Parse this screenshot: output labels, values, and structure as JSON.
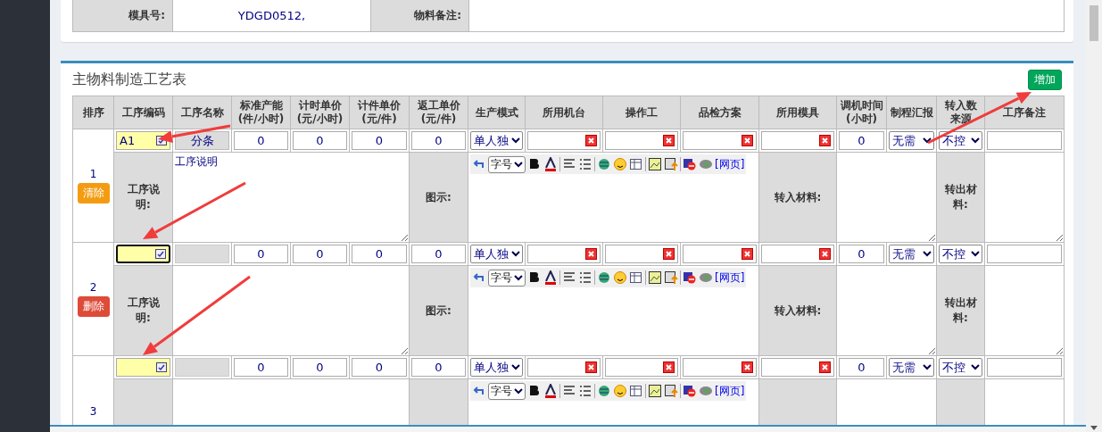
{
  "info_row": [
    {
      "label": "模具号:",
      "value": "YDGD0512,"
    },
    {
      "label": "物料备注:"
    }
  ],
  "section": {
    "title": "主物料制造工艺表",
    "add_button": "增加"
  },
  "columns": [
    "排序",
    "工序编码",
    "工序名称",
    "标准产能\n(件/小时)",
    "计时单价\n(元/小时)",
    "计件单价\n(元/件)",
    "返工单价\n(元/件)",
    "生产模式",
    "所用机台",
    "操作工",
    "品检方案",
    "所用模具",
    "调机时间\n(小时)",
    "制程汇报",
    "转入数来源",
    "工序备注"
  ],
  "rows": [
    {
      "seq": "1",
      "action": {
        "kind": "clear",
        "label": "清除"
      },
      "code": {
        "value": "A1",
        "focused": false
      },
      "name_button": "分条",
      "capacity": "0",
      "hourly_price": "0",
      "piece_price": "0",
      "rework_price": "0",
      "mode": "单人独",
      "adjust_time": "0",
      "report": "无需",
      "source": "不控",
      "editor": {
        "font_select": "字号",
        "link": "[网页]"
      },
      "detail": {
        "description_label": "工序说明:",
        "description": "工序说明",
        "diagram_label": "图示:",
        "input_material_label": "转入材料:",
        "output_material_label": "转出材料:"
      }
    },
    {
      "seq": "2",
      "action": {
        "kind": "delete",
        "label": "删除"
      },
      "code": {
        "focused": true
      },
      "capacity": "0",
      "hourly_price": "0",
      "piece_price": "0",
      "rework_price": "0",
      "mode": "单人独",
      "adjust_time": "0",
      "report": "无需",
      "source": "不控",
      "editor": {
        "font_select": "字号",
        "link": "[网页]"
      },
      "detail": {
        "description_label": "工序说明:",
        "diagram_label": "图示:",
        "input_material_label": "转入材料:",
        "output_material_label": "转出材料:"
      }
    },
    {
      "seq": "3",
      "code": {
        "focused": false
      },
      "capacity": "0",
      "hourly_price": "0",
      "piece_price": "0",
      "rework_price": "0",
      "mode": "单人独",
      "adjust_time": "0",
      "report": "无需",
      "source": "不控",
      "editor": {
        "font_select": "字号",
        "link": "[网页]"
      }
    }
  ]
}
